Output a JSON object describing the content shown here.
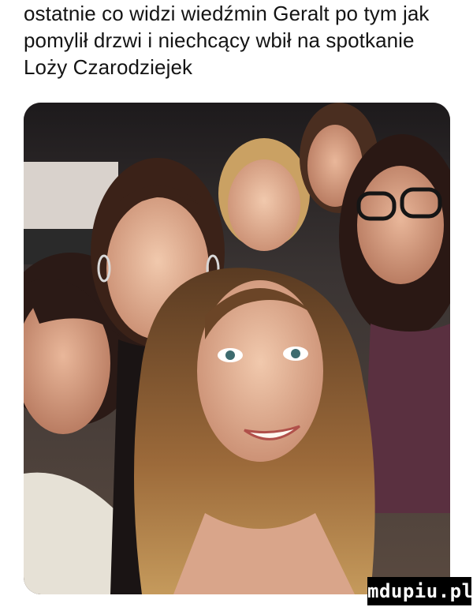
{
  "caption": {
    "text": "ostatnie co widzi wiedźmin Geralt po tym jak\npomylił drzwi i niechcący wbił na spotkanie\nLoży Czarodziejek"
  },
  "photo": {
    "subject": "selfie-group-of-women"
  },
  "watermark": {
    "text": "mdupiu.pl"
  }
}
